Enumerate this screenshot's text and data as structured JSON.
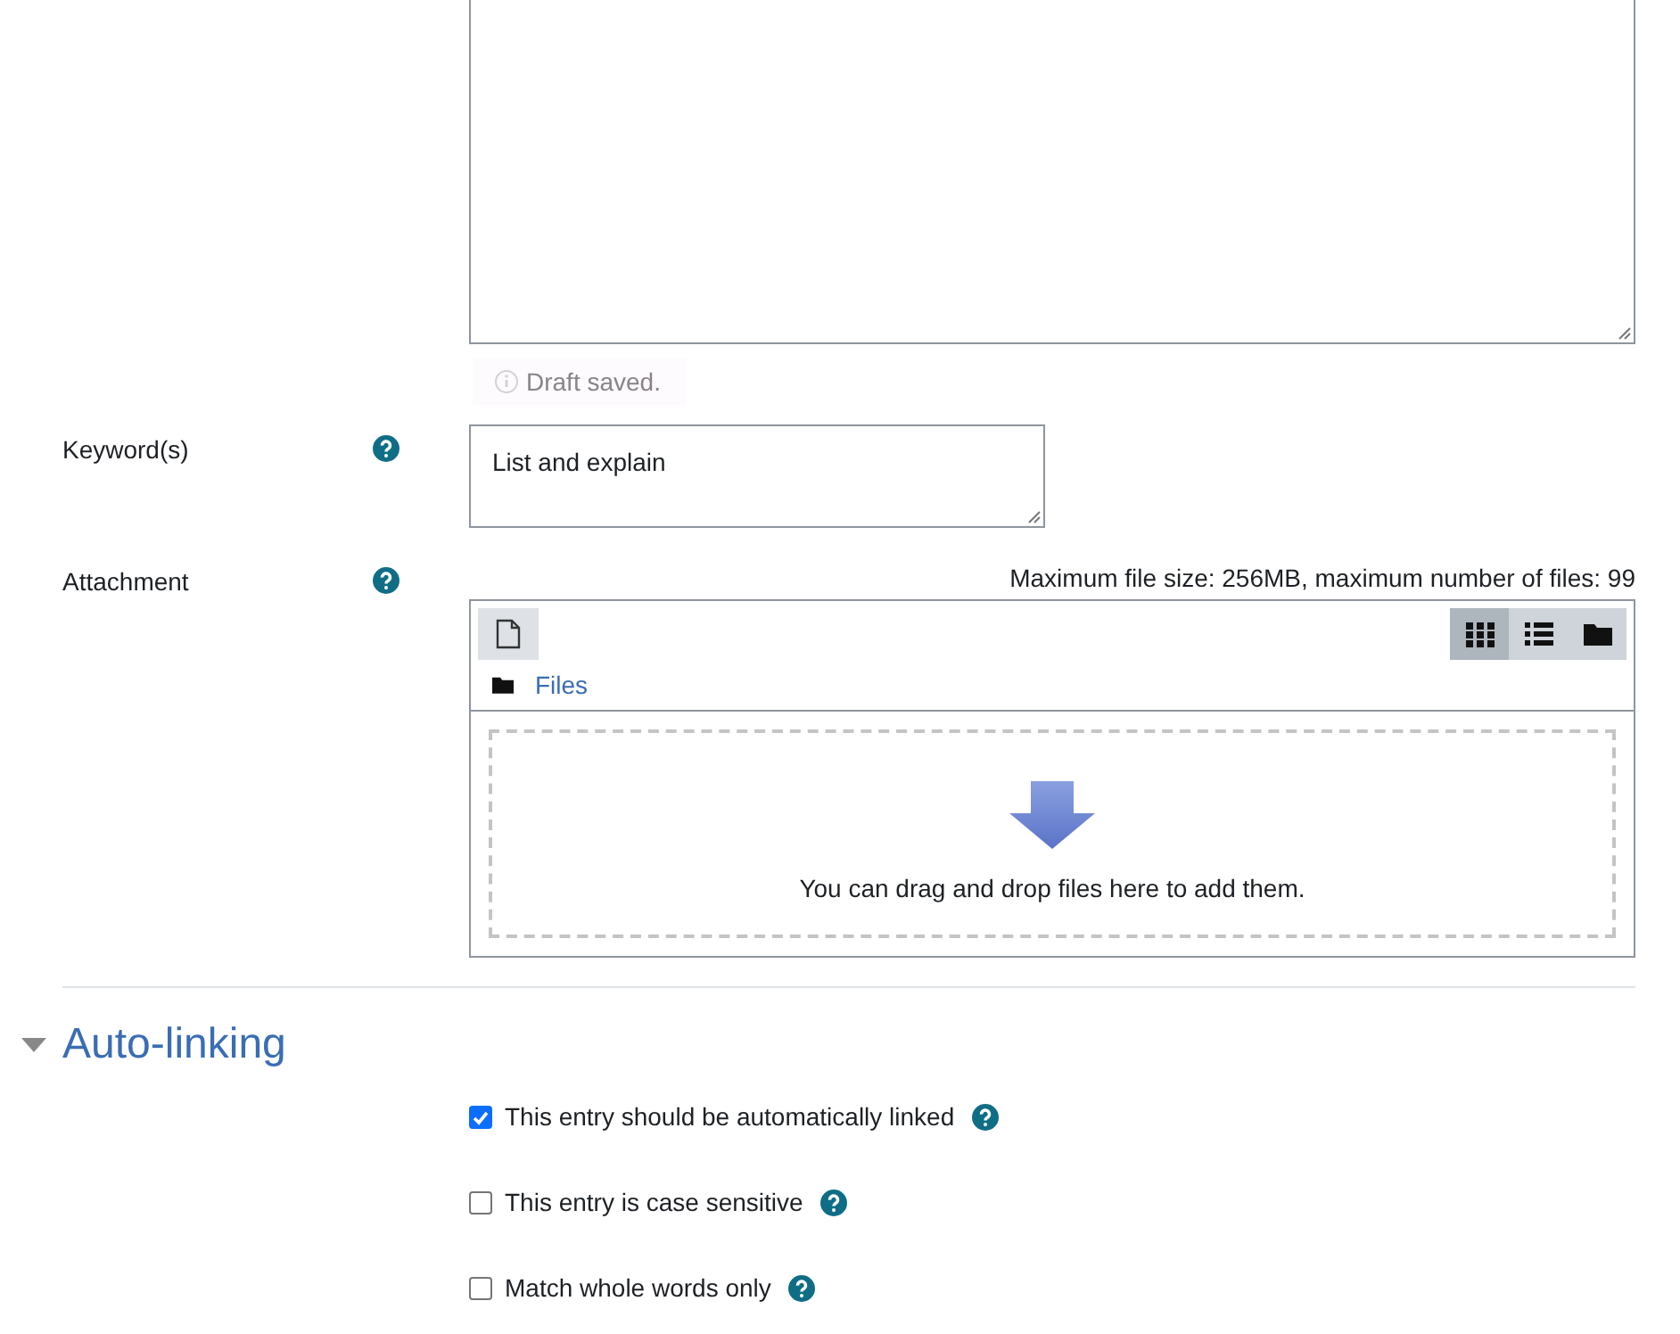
{
  "draft_status": "Draft saved.",
  "keywords": {
    "label": "Keyword(s)",
    "value": "List and explain"
  },
  "attachment": {
    "label": "Attachment",
    "limits": "Maximum file size: 256MB, maximum number of files: 99",
    "views": [
      {
        "kind": "grid",
        "selected": true
      },
      {
        "kind": "list",
        "selected": false
      },
      {
        "kind": "tree",
        "selected": false
      }
    ],
    "path": "Files",
    "drop_hint": "You can drag and drop files here to add them."
  },
  "section": {
    "title": "Auto-linking",
    "expanded": true
  },
  "options": [
    {
      "label": "This entry should be automatically linked",
      "checked": true
    },
    {
      "label": "This entry is case sensitive",
      "checked": false
    },
    {
      "label": "Match whole words only",
      "checked": false
    }
  ]
}
